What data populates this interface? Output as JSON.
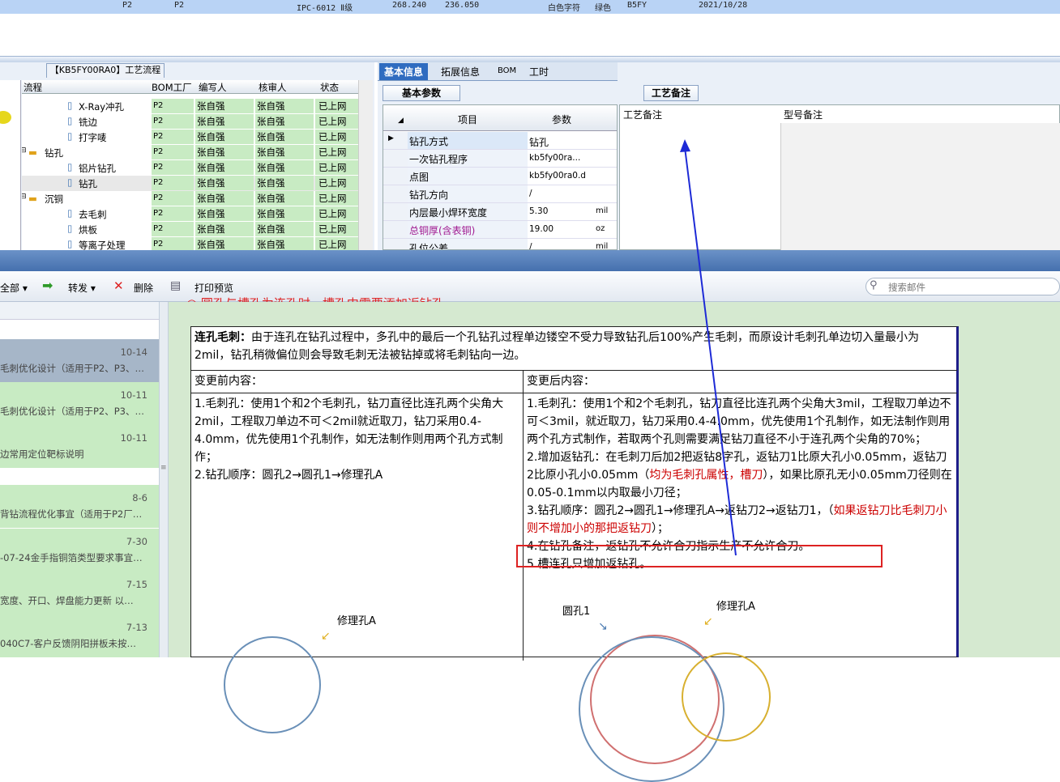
{
  "topbar": {
    "c1": "P2",
    "c2": "P2",
    "c3": "IPC-6012 Ⅱ级",
    "c4": "268.240",
    "c5": "236.050",
    "c6": "白色字符",
    "c7": "绿色",
    "c8": "B5FY",
    "c9": "2021/10/28"
  },
  "process": {
    "tab": "【KB5FY00RA0】工艺流程",
    "headers": [
      "流程",
      "BOM工厂",
      "编写人",
      "核审人",
      "状态"
    ],
    "rows": [
      {
        "name": "X-Ray冲孔",
        "f": "P2",
        "w": "张自强",
        "r": "张自强",
        "s": "已上网",
        "type": "leaf"
      },
      {
        "name": "铣边",
        "f": "P2",
        "w": "张自强",
        "r": "张自强",
        "s": "已上网",
        "type": "leaf"
      },
      {
        "name": "打字唛",
        "f": "P2",
        "w": "张自强",
        "r": "张自强",
        "s": "已上网",
        "type": "leaf"
      },
      {
        "name": "钻孔",
        "f": "P2",
        "w": "张自强",
        "r": "张自强",
        "s": "已上网",
        "type": "folder"
      },
      {
        "name": "铝片钻孔",
        "f": "P2",
        "w": "张自强",
        "r": "张自强",
        "s": "已上网",
        "type": "leaf"
      },
      {
        "name": "钻孔",
        "f": "P2",
        "w": "张自强",
        "r": "张自强",
        "s": "已上网",
        "type": "leaf"
      },
      {
        "name": "沉铜",
        "f": "P2",
        "w": "张自强",
        "r": "张自强",
        "s": "已上网",
        "type": "folder"
      },
      {
        "name": "去毛刺",
        "f": "P2",
        "w": "张自强",
        "r": "张自强",
        "s": "已上网",
        "type": "leaf"
      },
      {
        "name": "烘板",
        "f": "P2",
        "w": "张自强",
        "r": "张自强",
        "s": "已上网",
        "type": "leaf"
      },
      {
        "name": "等离子处理",
        "f": "P2",
        "w": "张自强",
        "r": "张自强",
        "s": "已上网",
        "type": "leaf"
      }
    ]
  },
  "basic": {
    "tabs": [
      "基本信息",
      "拓展信息",
      "BOM",
      "工时"
    ],
    "subtab": "基本参数",
    "col_item": "项目",
    "col_param": "参数",
    "rows": [
      {
        "k": "钻孔方式",
        "v": "钻孔",
        "u": ""
      },
      {
        "k": "一次钻孔程序",
        "v": "kb5fy00ra...",
        "u": ""
      },
      {
        "k": "点图",
        "v": "kb5fy00ra0.d",
        "u": ""
      },
      {
        "k": "钻孔方向",
        "v": "/",
        "u": ""
      },
      {
        "k": "内层最小焊环宽度",
        "v": "5.30",
        "u": "mil"
      },
      {
        "k": "总铜厚(含表铜)",
        "v": "19.00",
        "u": "oz"
      },
      {
        "k": "孔位公差",
        "v": "/",
        "u": "mil"
      }
    ]
  },
  "remark": {
    "tab": "工艺备注",
    "col1": "工艺备注",
    "col2": "型号备注"
  },
  "toolbar": {
    "all": "全部",
    "forward": "转发",
    "delete": "删除",
    "print": "打印预览",
    "search_ph": "搜索邮件"
  },
  "mails": [
    {
      "date": "10-14",
      "subj": "毛刺优化设计（适用于P2、P3、…"
    },
    {
      "date": "10-11",
      "subj": "毛刺优化设计（适用于P2、P3、…"
    },
    {
      "date": "10-11",
      "subj": "边常用定位靶标说明"
    },
    {
      "date": "8-6",
      "subj": "背钻流程优化事宜（适用于P2厂…"
    },
    {
      "date": "7-30",
      "subj": "-07-24金手指铜箔类型要求事宜…"
    },
    {
      "date": "7-15",
      "subj": "宽度、开口、焊盘能力更新 以…"
    },
    {
      "date": "7-13",
      "subj": "040C7-客户反馈阴阳拼板未按…"
    }
  ],
  "doc": {
    "heading_bold": "连孔毛刺：",
    "heading_text": "由于连孔在钻孔过程中，多孔中的最后一个孔钻孔过程单边镂空不受力导致钻孔后100%产生毛刺，而原设计毛刺孔单边切入量最小为2mil，钻孔稍微偏位则会导致毛刺无法被钻掉或将毛刺钻向一边。",
    "before_title": "变更前内容：",
    "after_title": "变更后内容：",
    "before_1": "1.毛刺孔：使用1个和2个毛刺孔，钻刀直径比连孔两个尖角大2mil，工程取刀单边不可＜2mil就近取刀，钻刀采用0.4-4.0mm，优先使用1个孔制作，如无法制作则用两个孔方式制作；",
    "before_2": "2.钻孔顺序：圆孔2→圆孔1→修理孔A",
    "after_1": "1.毛刺孔：使用1个和2个毛刺孔，钻刀直径比连孔两个尖角大3mil，工程取刀单边不可＜3mil，就近取刀，钻刀采用0.4-4.0mm，优先使用1个孔制作，如无法制作则用两个孔方式制作，若取两个孔则需要满足钻刀直径不小于连孔两个尖角的70%；",
    "after_2a": "2.增加返钻孔：在毛刺刀后加2把返钻8字孔，返钻刀1比原大孔小0.05mm，返钻刀2比原小孔小0.05mm（",
    "after_2red": "均为毛刺孔属性，槽刀",
    "after_2b": "），如果比原孔无小0.05mm刀径则在0.05-0.1mm以内取最小刀径；",
    "after_3a": "3.钻孔顺序：圆孔2→圆孔1→修理孔A→返钻刀2→返钻刀1，（",
    "after_3red": "如果返钻刀比毛刺刀小则不增加小的那把返钻刀",
    "after_3b": "）；",
    "after_4": "4.在钻孔备注，返钻孔不允许合刀指示生产不允许合刀。",
    "after_5": "5.槽连孔只增加返钻孔。",
    "fig_before_label": "修理孔A",
    "fig_after_label1": "圆孔1",
    "fig_after_label2": "修理孔A"
  },
  "colors": {
    "accent": "#2f6cc0",
    "highlight": "#c8ebc3",
    "arrow": "#1d2ad6",
    "box": "#dd2222"
  }
}
